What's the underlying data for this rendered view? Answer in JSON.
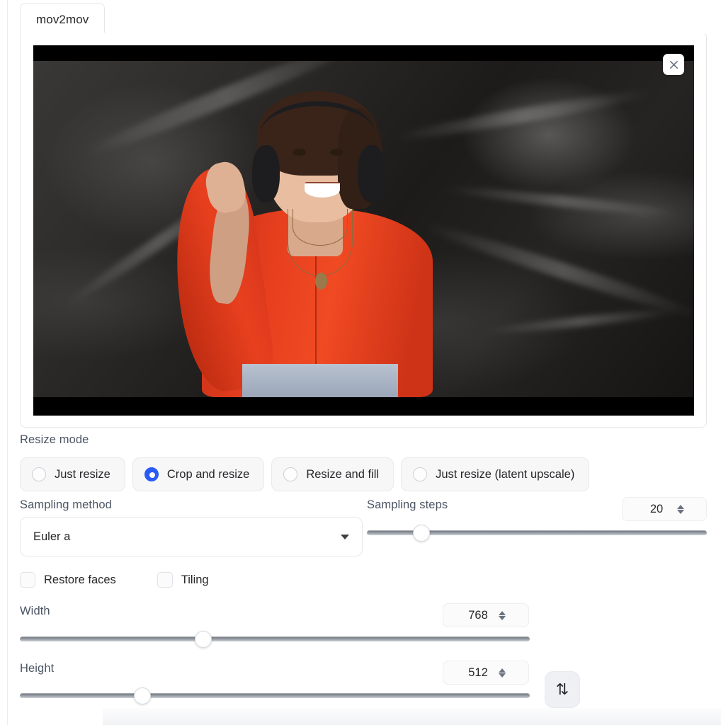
{
  "tab": {
    "label": "mov2mov"
  },
  "video": {
    "close_icon": "close-icon",
    "alt": "video preview frame"
  },
  "resize_mode": {
    "label": "Resize mode",
    "options": [
      {
        "label": "Just resize",
        "selected": false
      },
      {
        "label": "Crop and resize",
        "selected": true
      },
      {
        "label": "Resize and fill",
        "selected": false
      },
      {
        "label": "Just resize (latent upscale)",
        "selected": false
      }
    ],
    "selected_color": "#2a5cf5"
  },
  "sampling": {
    "method_label": "Sampling method",
    "method_value": "Euler a",
    "steps_label": "Sampling steps",
    "steps_value": "20",
    "steps_percent": 16
  },
  "toggles": [
    {
      "label": "Restore faces",
      "checked": false
    },
    {
      "label": "Tiling",
      "checked": false
    }
  ],
  "dimensions": {
    "width_label": "Width",
    "width_value": "768",
    "width_percent": 36,
    "height_label": "Height",
    "height_value": "512",
    "height_percent": 24,
    "swap_icon": "⇅"
  }
}
